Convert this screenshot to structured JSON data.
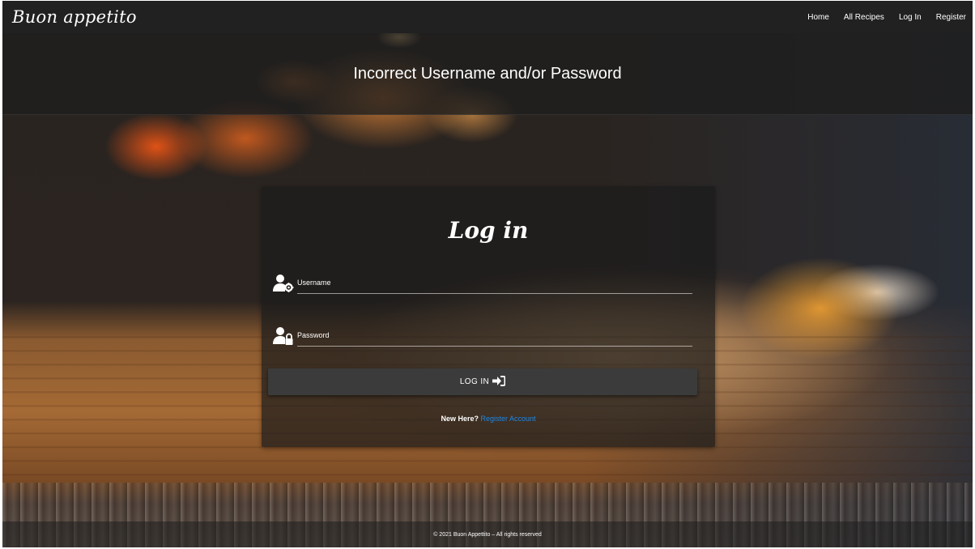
{
  "navbar": {
    "brand": "Buon appetito",
    "links": [
      "Home",
      "All Recipes",
      "Log In",
      "Register"
    ]
  },
  "flash": {
    "message": "Incorrect Username and/or Password"
  },
  "login_card": {
    "title": "Log in",
    "username_label": "Username",
    "password_label": "Password",
    "submit_label": "LOG IN",
    "register_prompt": "New Here?",
    "register_link": "Register Account",
    "icons": {
      "username": "user-gear-icon",
      "password": "user-lock-icon",
      "submit": "sign-in-icon"
    }
  },
  "footer": {
    "text": "© 2021 Buon Appettito – All rights reserved"
  },
  "colors": {
    "navbar_bg": "#212121",
    "link_blue": "#1e88e5",
    "button_bg": "#3b3b3b"
  }
}
